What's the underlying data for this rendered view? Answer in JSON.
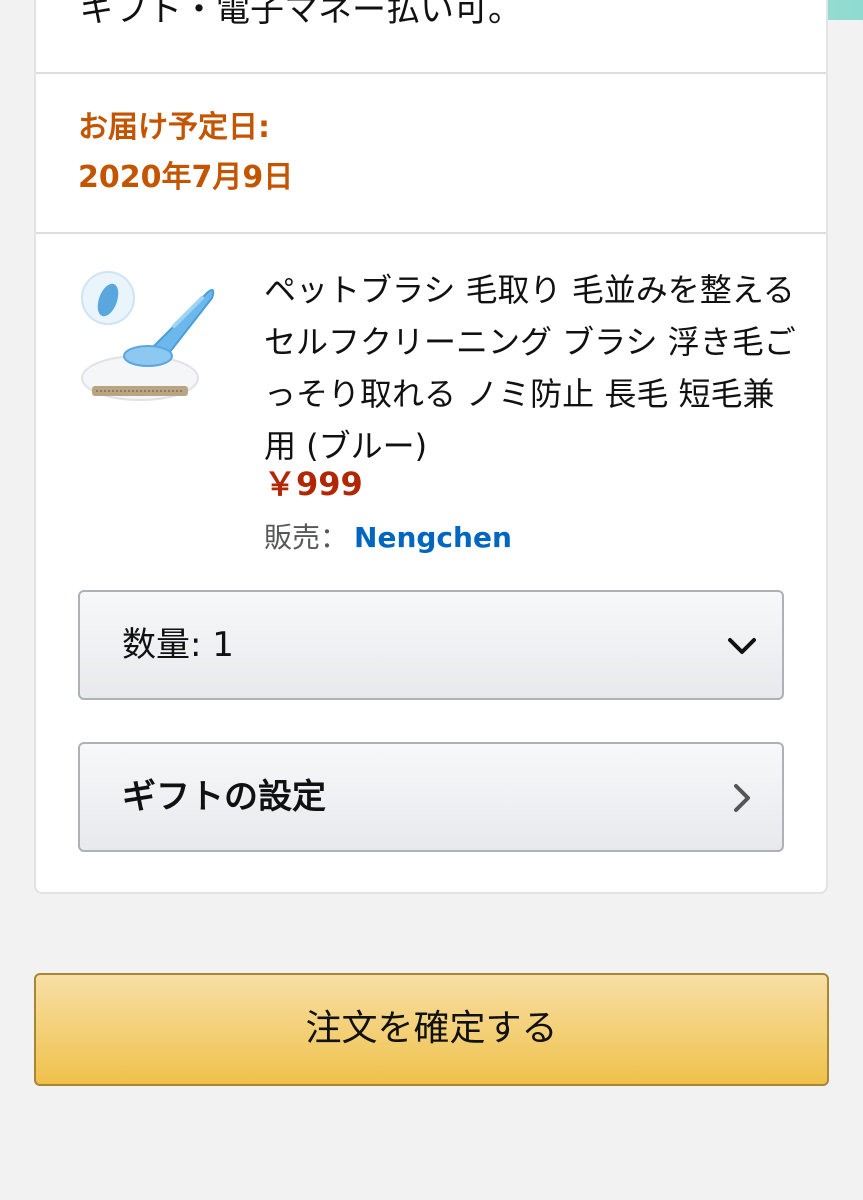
{
  "previous_section": {
    "text": "ギフト・電子マネー払い可。"
  },
  "delivery": {
    "label": "お届け予定日:",
    "date": "2020年7月9日"
  },
  "product": {
    "title": "ペットブラシ 毛取り 毛並みを整える セルフクリーニング ブラシ 浮き毛ごっそり取れる ノミ防止 長毛 短毛兼用 (ブルー)",
    "price": "￥999",
    "seller_label": "販売：",
    "seller_name": "Nengchen"
  },
  "quantity": {
    "label": "数量:",
    "value": "1",
    "icon": "chevron-down-icon"
  },
  "gift": {
    "label": "ギフトの設定",
    "icon": "chevron-right-icon"
  },
  "place_order": {
    "label": "注文を確定する"
  },
  "colors": {
    "delivery_text": "#c45500",
    "price": "#b12704",
    "seller_link": "#0066c0",
    "button_yellow": "#f0c14b"
  }
}
